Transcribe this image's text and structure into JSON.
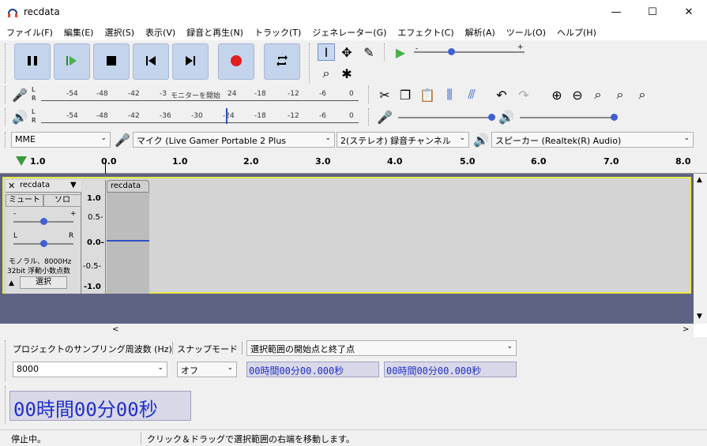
{
  "window": {
    "title": "recdata",
    "minimize": "—",
    "maximize": "☐",
    "close": "✕"
  },
  "menu": [
    "ファイル(F)",
    "編集(E)",
    "選択(S)",
    "表示(V)",
    "録音と再生(N)",
    "トラック(T)",
    "ジェネレーター(G)",
    "エフェクト(C)",
    "解析(A)",
    "ツール(O)",
    "ヘルプ(H)"
  ],
  "meters": {
    "record_ticks": [
      "-54",
      "-48",
      "-42",
      "-3",
      "モニターを開始",
      "24",
      "-18",
      "-12",
      "-6",
      "0"
    ],
    "play_ticks": [
      "-54",
      "-48",
      "-42",
      "-36",
      "-30",
      "-24",
      "-18",
      "-12",
      "-6",
      "0"
    ]
  },
  "device": {
    "host": "MME",
    "mic": "マイク (Live Gamer Portable 2 Plus",
    "channels": "2(ステレオ) 録音チャンネル",
    "speaker": "スピーカー (Realtek(R) Audio)"
  },
  "ruler": {
    "ticks": [
      "1.0",
      "0.0",
      "1.0",
      "2.0",
      "3.0",
      "4.0",
      "5.0",
      "6.0",
      "7.0",
      "8.0"
    ]
  },
  "track": {
    "name": "recdata",
    "clip_name": "recdata",
    "mute": "ミュート",
    "solo": "ソロ",
    "gain_minus": "-",
    "gain_plus": "+",
    "pan_left": "L",
    "pan_right": "R",
    "info_line1": "モノラル、8000Hz",
    "info_line2": "32bit 浮動小数点数",
    "select": "選択",
    "scale": [
      "1.0",
      "0.5-",
      "0.0-",
      "-0.5-",
      "-1.0"
    ]
  },
  "bottom": {
    "rate_label": "プロジェクトのサンプリング周波数 (Hz)",
    "snap_label": "スナップモード",
    "selection_mode": "選択範囲の開始点と終了点",
    "rate_value": "8000",
    "snap_value": "オフ",
    "sel_start": "00時間00分00.000秒",
    "sel_end": "00時間00分00.000秒",
    "big_time": "00時間00分00秒"
  },
  "status": {
    "left": "停止中。",
    "right": "クリック＆ドラッグで選択範囲の右端を移動します。"
  }
}
